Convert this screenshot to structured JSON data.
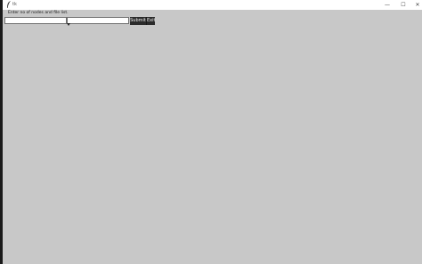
{
  "window": {
    "title": "tk",
    "icon": "feather-icon",
    "controls": {
      "minimize_glyph": "—",
      "maximize_glyph": "☐",
      "close_glyph": "✕"
    }
  },
  "form": {
    "prompt": "Enter no of nodes and file list.",
    "nodes_input_value": "",
    "files_input_value": "",
    "submit_label": "Submit",
    "exit_label": "Exit"
  },
  "colors": {
    "background": "#c8c8c8",
    "button_bg": "#2b2b2b",
    "button_fg": "#f2f2f2"
  }
}
